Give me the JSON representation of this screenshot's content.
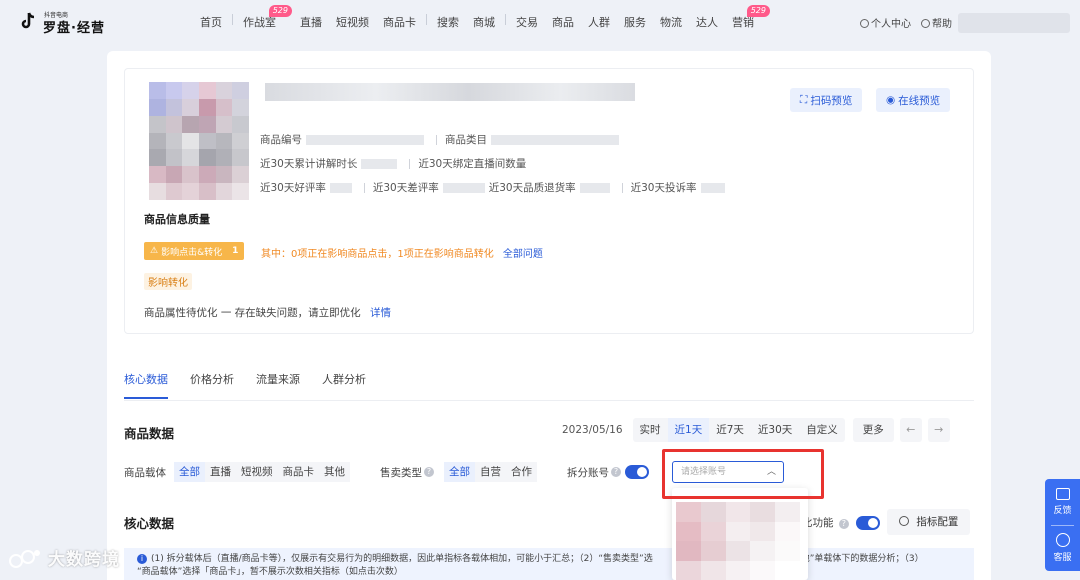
{
  "brand": {
    "small": "抖音电商",
    "name": "罗盘·经营"
  },
  "nav": {
    "items": [
      {
        "label": "首页"
      },
      {
        "label": "作战室",
        "badge": "529"
      },
      {
        "label": "直播"
      },
      {
        "label": "短视频"
      },
      {
        "label": "商品卡"
      },
      {
        "label": "搜索"
      },
      {
        "label": "商城"
      },
      {
        "label": "交易"
      },
      {
        "label": "商品"
      },
      {
        "label": "人群"
      },
      {
        "label": "服务"
      },
      {
        "label": "物流"
      },
      {
        "label": "达人"
      },
      {
        "label": "营销",
        "badge": "529"
      }
    ],
    "personal": "个人中心",
    "help": "帮助"
  },
  "hero": {
    "product_code_label": "商品编号",
    "category_label": "商品类目",
    "explain_label": "近30天累计讲解时长",
    "bound_live_label": "近30天绑定直播间数量",
    "good_rate_label": "近30天好评率",
    "bad_rate_label": "近30天差评率",
    "quality_refund_label": "近30天品质退货率",
    "complaint_label": "近30天投诉率",
    "scan_preview": "扫码预览",
    "online_preview": "在线预览",
    "quality_title": "商品信息质量",
    "impact_tag": "影响点击&转化",
    "impact_count": "1",
    "impact_text": "其中：0项正在影响商品点击，1项正在影响商品转化",
    "all_issues": "全部问题",
    "impact_conv_tag": "影响转化",
    "optim_text": "商品属性待优化 一 存在缺失问题，请立即优化",
    "detail_link": "详情"
  },
  "tabs": [
    {
      "label": "核心数据",
      "active": true
    },
    {
      "label": "价格分析"
    },
    {
      "label": "流量来源"
    },
    {
      "label": "人群分析"
    }
  ],
  "product_data": {
    "title": "商品数据",
    "date": "2023/05/16",
    "ranges": [
      {
        "label": "实时"
      },
      {
        "label": "近1天",
        "active": true
      },
      {
        "label": "近7天"
      },
      {
        "label": "近30天"
      },
      {
        "label": "自定义"
      }
    ],
    "more": "更多",
    "prev": "←",
    "next": "→"
  },
  "filters": {
    "carrier_label": "商品载体",
    "carrier": [
      "全部",
      "直播",
      "短视频",
      "商品卡",
      "其他"
    ],
    "sale_type_label": "售卖类型",
    "sale_type": [
      "全部",
      "自营",
      "合作"
    ],
    "split_label": "拆分账号",
    "account_placeholder": "请选择账号"
  },
  "core": {
    "title": "核心数据",
    "compare_label": "比功能",
    "metric_config": "指标配置",
    "note": "（1）拆分载体后（直播/商品卡等），仅展示有交易行为的明细数据，因此单指标各载体相加，可能小于汇总；（2）“售卖类型”选择「自营」或「合作」，仅展示「直播、短视频、商品卡&其他」单载体下的数据分析；（3）“商品载体”选择「商品卡」，暂不展示次数相关指标（如点击次数）",
    "note_line1": "(1) 拆分载体后（直播/商品卡等），仅展示有交易行为的明细数据，因此单指标各载体相加，可能小于汇总；（2）“售卖类型”选",
    "note_line1b": "&其他”单载体下的数据分析；（3）",
    "note_line2": "“商品载体”选择「商品卡」，暂不展示次数相关指标（如点击次数）"
  },
  "side": {
    "feedback": "反馈",
    "service": "客服"
  },
  "watermark": "大数跨境",
  "colors": {
    "accent": "#2a5bd7",
    "warn": "#f7b64a",
    "highlight": "#e8332f",
    "side": "#3a6ff2"
  }
}
